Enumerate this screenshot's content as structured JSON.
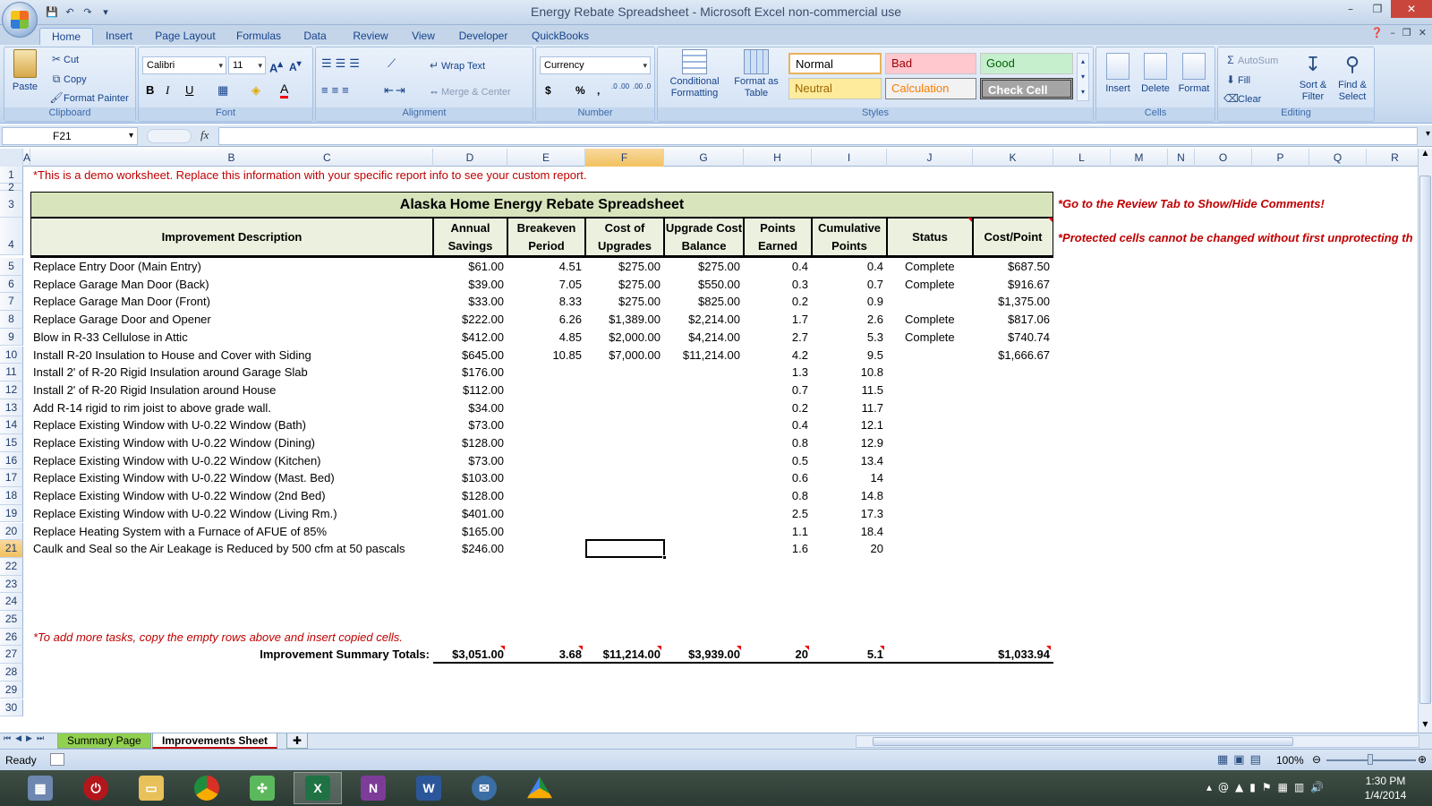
{
  "window": {
    "title": "Energy Rebate Spreadsheet - Microsoft Excel non-commercial use"
  },
  "tabs": [
    "Home",
    "Insert",
    "Page Layout",
    "Formulas",
    "Data",
    "Review",
    "View",
    "Developer",
    "QuickBooks"
  ],
  "ribbon": {
    "clipboard": {
      "paste": "Paste",
      "cut": "Cut",
      "copy": "Copy",
      "format_painter": "Format Painter",
      "label": "Clipboard"
    },
    "font": {
      "name": "Calibri",
      "size": "11",
      "label": "Font"
    },
    "alignment": {
      "wrap": "Wrap Text",
      "merge": "Merge & Center",
      "label": "Alignment"
    },
    "number": {
      "format": "Currency",
      "dollar": "$",
      "percent": "%",
      "comma": ",",
      "inc": ".0 .00",
      "dec": ".00 .0",
      "label": "Number"
    },
    "styles": {
      "conditional": "Conditional Formatting",
      "format_table": "Format as Table",
      "normal": "Normal",
      "bad": "Bad",
      "good": "Good",
      "neutral": "Neutral",
      "calculation": "Calculation",
      "check_cell": "Check Cell",
      "label": "Styles"
    },
    "cells": {
      "insert": "Insert",
      "delete": "Delete",
      "format": "Format",
      "label": "Cells"
    },
    "editing": {
      "autosum": "AutoSum",
      "fill": "Fill",
      "clear": "Clear",
      "sort": "Sort & Filter",
      "find": "Find & Select",
      "label": "Editing"
    }
  },
  "formula_bar": {
    "name_box": "F21",
    "fx": "fx",
    "content": ""
  },
  "columns": [
    "A",
    "B",
    "C",
    "D",
    "E",
    "F",
    "G",
    "H",
    "I",
    "J",
    "K",
    "L",
    "M",
    "N",
    "O",
    "P",
    "Q",
    "R"
  ],
  "sheet": {
    "note_top": "*This is a demo worksheet. Replace this information with your specific report info to see your custom report.",
    "title": "Alaska Home Energy Rebate Spreadsheet",
    "note_review": "*Go to the Review Tab to Show/Hide Comments!",
    "note_protected": "*Protected cells cannot be changed without first unprotecting th",
    "headers": {
      "desc": "Improvement Description",
      "savings": [
        "Annual",
        "Savings"
      ],
      "breakeven": [
        "Breakeven",
        "Period"
      ],
      "cost": [
        "Cost of",
        "Upgrades"
      ],
      "balance": [
        "Upgrade Cost",
        "Balance"
      ],
      "points": [
        "Points",
        "Earned"
      ],
      "cumulative": [
        "Cumulative",
        "Points"
      ],
      "status": "Status",
      "costpoint": "Cost/Point"
    },
    "rows": [
      {
        "n": "5",
        "d": "Replace Entry Door (Main Entry)",
        "s": "$61.00",
        "b": "4.51",
        "c": "$275.00",
        "g": "$275.00",
        "p": "0.4",
        "cu": "0.4",
        "st": "Complete",
        "k": "$687.50"
      },
      {
        "n": "6",
        "d": "Replace Garage Man Door (Back)",
        "s": "$39.00",
        "b": "7.05",
        "c": "$275.00",
        "g": "$550.00",
        "p": "0.3",
        "cu": "0.7",
        "st": "Complete",
        "k": "$916.67"
      },
      {
        "n": "7",
        "d": "Replace Garage Man Door (Front)",
        "s": "$33.00",
        "b": "8.33",
        "c": "$275.00",
        "g": "$825.00",
        "p": "0.2",
        "cu": "0.9",
        "st": "",
        "k": "$1,375.00"
      },
      {
        "n": "8",
        "d": "Replace Garage Door and Opener",
        "s": "$222.00",
        "b": "6.26",
        "c": "$1,389.00",
        "g": "$2,214.00",
        "p": "1.7",
        "cu": "2.6",
        "st": "Complete",
        "k": "$817.06"
      },
      {
        "n": "9",
        "d": "Blow in R-33 Cellulose in Attic",
        "s": "$412.00",
        "b": "4.85",
        "c": "$2,000.00",
        "g": "$4,214.00",
        "p": "2.7",
        "cu": "5.3",
        "st": "Complete",
        "k": "$740.74"
      },
      {
        "n": "10",
        "d": "Install R-20 Insulation to House and Cover with Siding",
        "s": "$645.00",
        "b": "10.85",
        "c": "$7,000.00",
        "g": "$11,214.00",
        "p": "4.2",
        "cu": "9.5",
        "st": "",
        "k": "$1,666.67"
      },
      {
        "n": "11",
        "d": "Install 2' of R-20 Rigid Insulation around Garage Slab",
        "s": "$176.00",
        "b": "",
        "c": "",
        "g": "",
        "p": "1.3",
        "cu": "10.8",
        "st": "",
        "k": ""
      },
      {
        "n": "12",
        "d": "Install 2' of R-20 Rigid Insulation around House",
        "s": "$112.00",
        "b": "",
        "c": "",
        "g": "",
        "p": "0.7",
        "cu": "11.5",
        "st": "",
        "k": ""
      },
      {
        "n": "13",
        "d": "Add R-14 rigid to rim joist to above grade wall.",
        "s": "$34.00",
        "b": "",
        "c": "",
        "g": "",
        "p": "0.2",
        "cu": "11.7",
        "st": "",
        "k": ""
      },
      {
        "n": "14",
        "d": "Replace Existing Window with U-0.22 Window (Bath)",
        "s": "$73.00",
        "b": "",
        "c": "",
        "g": "",
        "p": "0.4",
        "cu": "12.1",
        "st": "",
        "k": ""
      },
      {
        "n": "15",
        "d": "Replace Existing Window with U-0.22 Window (Dining)",
        "s": "$128.00",
        "b": "",
        "c": "",
        "g": "",
        "p": "0.8",
        "cu": "12.9",
        "st": "",
        "k": ""
      },
      {
        "n": "16",
        "d": "Replace Existing Window with U-0.22 Window (Kitchen)",
        "s": "$73.00",
        "b": "",
        "c": "",
        "g": "",
        "p": "0.5",
        "cu": "13.4",
        "st": "",
        "k": ""
      },
      {
        "n": "17",
        "d": "Replace Existing Window with U-0.22 Window (Mast. Bed)",
        "s": "$103.00",
        "b": "",
        "c": "",
        "g": "",
        "p": "0.6",
        "cu": "14",
        "st": "",
        "k": ""
      },
      {
        "n": "18",
        "d": "Replace Existing Window with U-0.22 Window (2nd Bed)",
        "s": "$128.00",
        "b": "",
        "c": "",
        "g": "",
        "p": "0.8",
        "cu": "14.8",
        "st": "",
        "k": ""
      },
      {
        "n": "19",
        "d": "Replace Existing Window with U-0.22 Window (Living Rm.)",
        "s": "$401.00",
        "b": "",
        "c": "",
        "g": "",
        "p": "2.5",
        "cu": "17.3",
        "st": "",
        "k": ""
      },
      {
        "n": "20",
        "d": "Replace Heating System with a Furnace of AFUE of 85%",
        "s": "$165.00",
        "b": "",
        "c": "",
        "g": "",
        "p": "1.1",
        "cu": "18.4",
        "st": "",
        "k": ""
      },
      {
        "n": "21",
        "d": "Caulk and Seal so the Air Leakage is Reduced by 500 cfm at 50 pascals",
        "s": "$246.00",
        "b": "",
        "c": "",
        "g": "",
        "p": "1.6",
        "cu": "20",
        "st": "",
        "k": ""
      }
    ],
    "note_add": "*To add more tasks, copy the empty rows above and insert copied cells.",
    "totals": {
      "label": "Improvement Summary Totals:",
      "s": "$3,051.00",
      "b": "3.68",
      "c": "$11,214.00",
      "g": "$3,939.00",
      "p": "20",
      "cu": "5.1",
      "k": "$1,033.94"
    }
  },
  "sheet_tabs": [
    "Summary Page",
    "Improvements Sheet"
  ],
  "status": {
    "ready": "Ready",
    "zoom": "100%"
  },
  "clock": {
    "time": "1:30 PM",
    "date": "1/4/2014"
  },
  "colors": {
    "header_fill": "#ebf1de",
    "title_fill": "#d8e4bc",
    "note_red": "#c00000",
    "excel_green": "#1f7244"
  }
}
